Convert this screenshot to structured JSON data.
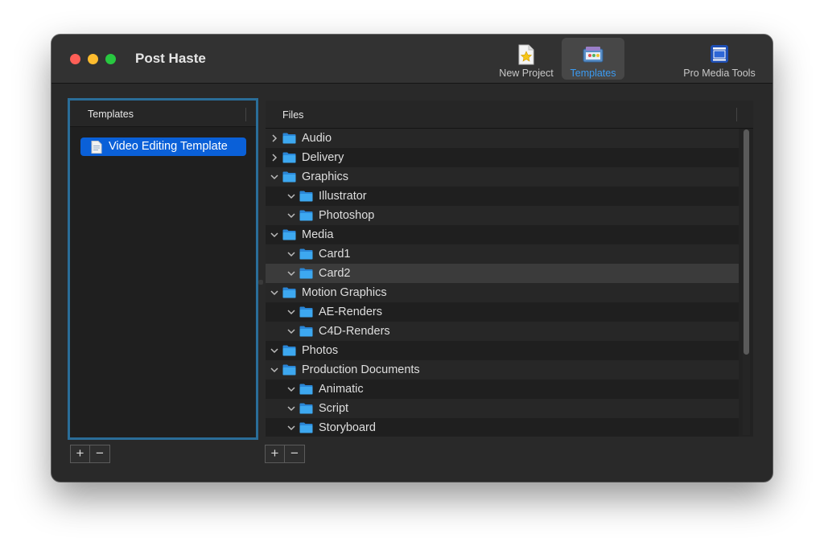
{
  "window": {
    "title": "Post Haste"
  },
  "toolbar": {
    "new_project": "New Project",
    "templates": "Templates",
    "pro_media_tools": "Pro Media Tools"
  },
  "templates_panel": {
    "header": "Templates",
    "items": [
      {
        "label": "Video Editing Template",
        "selected": true
      }
    ]
  },
  "files_panel": {
    "header": "Files",
    "rows": [
      {
        "label": "Audio",
        "level": 0,
        "expanded": false
      },
      {
        "label": "Delivery",
        "level": 0,
        "expanded": false
      },
      {
        "label": "Graphics",
        "level": 0,
        "expanded": true
      },
      {
        "label": "Illustrator",
        "level": 1,
        "expanded": true
      },
      {
        "label": "Photoshop",
        "level": 1,
        "expanded": true
      },
      {
        "label": "Media",
        "level": 0,
        "expanded": true
      },
      {
        "label": "Card1",
        "level": 1,
        "expanded": true
      },
      {
        "label": "Card2",
        "level": 1,
        "expanded": true,
        "selected": true
      },
      {
        "label": "Motion Graphics",
        "level": 0,
        "expanded": true
      },
      {
        "label": "AE-Renders",
        "level": 1,
        "expanded": true
      },
      {
        "label": "C4D-Renders",
        "level": 1,
        "expanded": true
      },
      {
        "label": "Photos",
        "level": 0,
        "expanded": true
      },
      {
        "label": "Production Documents",
        "level": 0,
        "expanded": true
      },
      {
        "label": "Animatic",
        "level": 1,
        "expanded": true
      },
      {
        "label": "Script",
        "level": 1,
        "expanded": true
      },
      {
        "label": "Storyboard",
        "level": 1,
        "expanded": true
      }
    ]
  },
  "buttons": {
    "add": "+",
    "remove": "−"
  },
  "colors": {
    "accent": "#0a60d8",
    "selected_tab_text": "#3b9bf2",
    "focus_ring": "#2a6d98",
    "folder": "#3da8f0"
  }
}
